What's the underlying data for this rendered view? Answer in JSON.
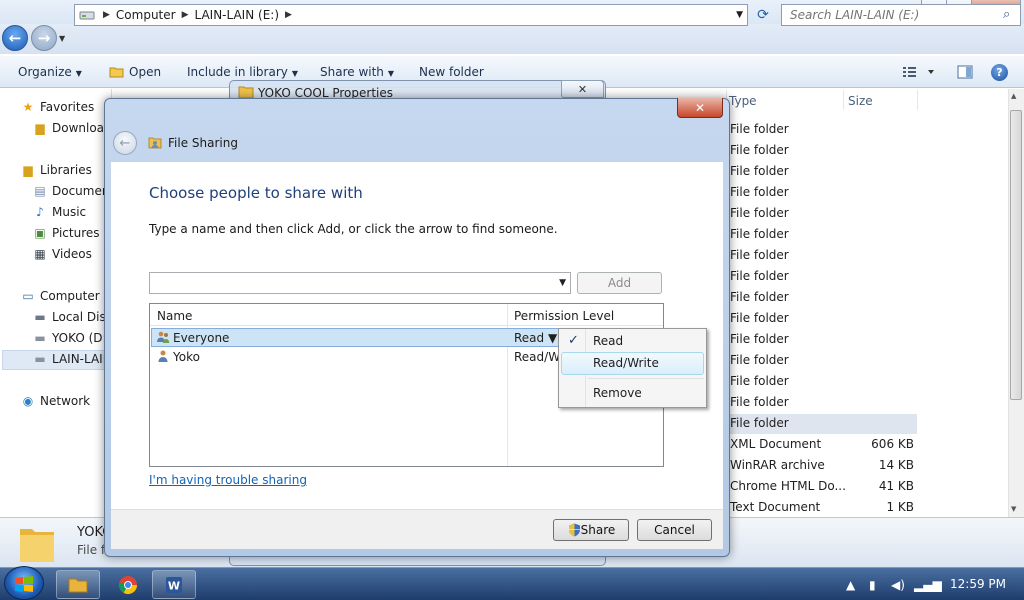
{
  "explorer": {
    "window_controls": {
      "minimize": "—",
      "maximize": "▢",
      "close": "✕"
    },
    "address": {
      "segments": [
        "Computer",
        "LAIN-LAIN (E:)"
      ],
      "separator": "▶"
    },
    "search_placeholder": "Search LAIN-LAIN (E:)",
    "toolbar": {
      "organize": "Organize",
      "open": "Open",
      "include_in_library": "Include in library",
      "share_with": "Share with",
      "new_folder": "New folder",
      "help": "?"
    },
    "nav_pane": {
      "favorites": "Favorites",
      "downloads": "Downloads",
      "libraries": "Libraries",
      "documents": "Documents",
      "music": "Music",
      "pictures": "Pictures",
      "videos": "Videos",
      "computer": "Computer",
      "local_disk": "Local Disk (C:)",
      "yoko": "YOKO (D:)",
      "lain": "LAIN-LAIN (E:)",
      "network": "Network"
    },
    "columns": {
      "type": "Type",
      "size": "Size"
    },
    "files": [
      {
        "type": "File folder",
        "size": ""
      },
      {
        "type": "File folder",
        "size": ""
      },
      {
        "type": "File folder",
        "size": ""
      },
      {
        "type": "File folder",
        "size": ""
      },
      {
        "type": "File folder",
        "size": ""
      },
      {
        "type": "File folder",
        "size": ""
      },
      {
        "type": "File folder",
        "size": ""
      },
      {
        "type": "File folder",
        "size": ""
      },
      {
        "type": "File folder",
        "size": ""
      },
      {
        "type": "File folder",
        "size": ""
      },
      {
        "type": "File folder",
        "size": ""
      },
      {
        "type": "File folder",
        "size": ""
      },
      {
        "type": "File folder",
        "size": ""
      },
      {
        "type": "File folder",
        "size": ""
      },
      {
        "type": "File folder",
        "size": ""
      },
      {
        "type": "XML Document",
        "size": "606 KB"
      },
      {
        "type": "WinRAR archive",
        "size": "14 KB"
      },
      {
        "type": "Chrome HTML Do...",
        "size": "41 KB"
      },
      {
        "type": "Text Document",
        "size": "1 KB"
      }
    ],
    "details": {
      "name": "YOKO COOL",
      "type": "File folder"
    }
  },
  "properties_dialog": {
    "title": "YOKO COOL Properties",
    "close": "✕"
  },
  "share_dialog": {
    "close": "✕",
    "header": "File Sharing",
    "heading": "Choose people to share with",
    "instructions": "Type a name and then click Add, or click the arrow to find someone.",
    "name_input_value": "",
    "add_label": "Add",
    "columns": {
      "name": "Name",
      "permission": "Permission Level"
    },
    "people": [
      {
        "name": "Everyone",
        "permission": "Read ▼"
      },
      {
        "name": "Yoko",
        "permission": "Read/Write"
      }
    ],
    "trouble_link": "I'm having trouble sharing",
    "share_label": "Share",
    "cancel_label": "Cancel",
    "menu": {
      "read": "Read",
      "read_write": "Read/Write",
      "remove": "Remove",
      "check": "✓"
    }
  },
  "taskbar": {
    "clock": "12:59 PM"
  }
}
